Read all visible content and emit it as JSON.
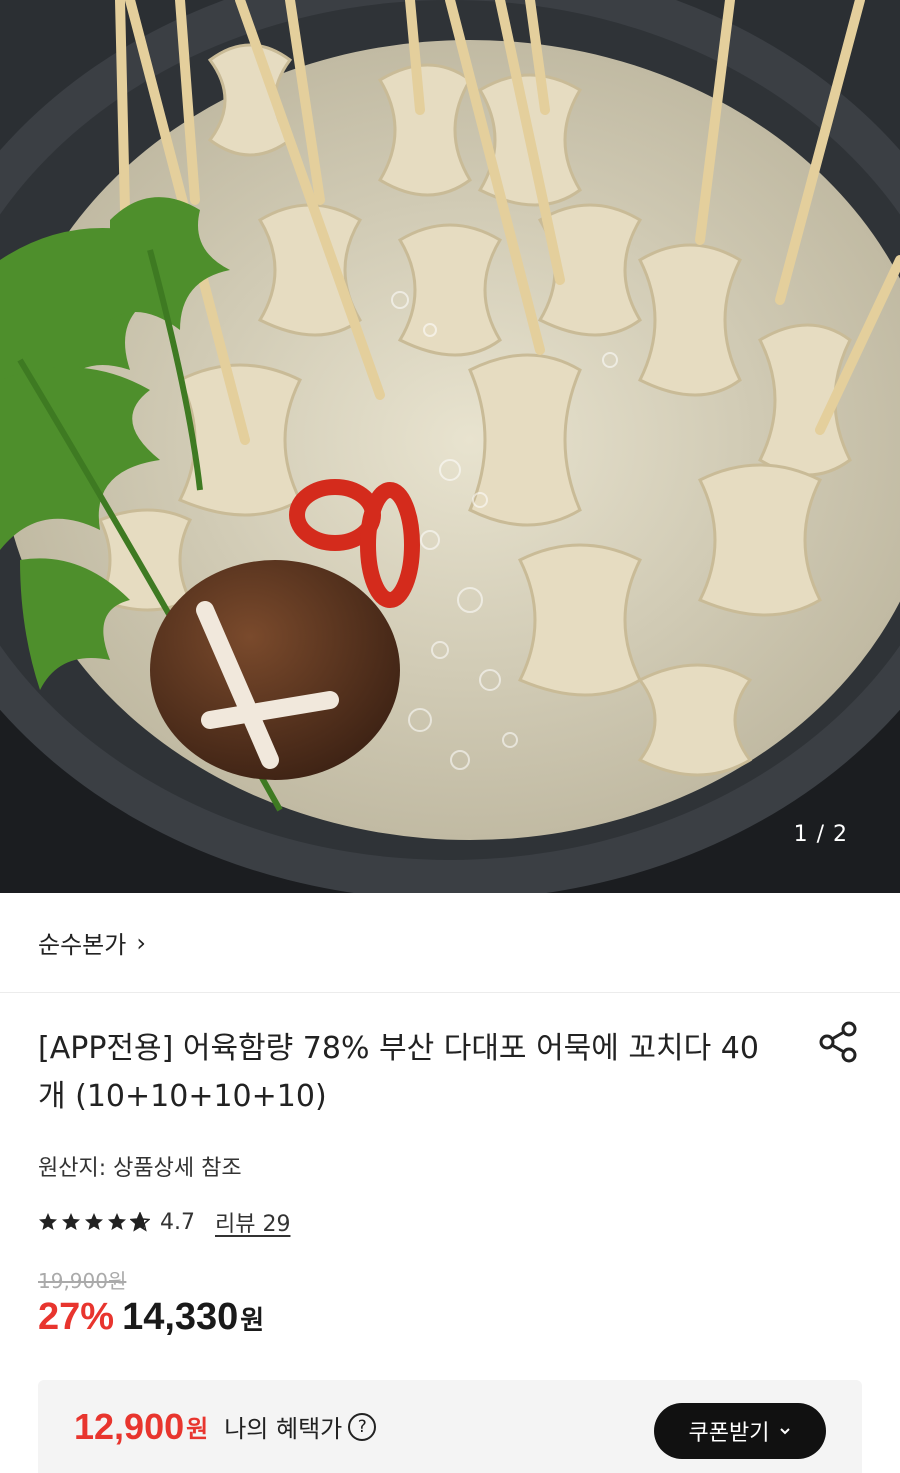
{
  "gallery": {
    "page_indicator": "1 / 2"
  },
  "brand": {
    "name": "순수본가",
    "chevron": "›"
  },
  "product": {
    "title": "[APP전용] 어육함량 78% 부산 다대포 어묵에 꼬치다 40개 (10+10+10+10)",
    "origin": "원산지: 상품상세 참조",
    "rating": "4.7",
    "rating_stars": 4.7,
    "review_link": "리뷰 29",
    "original_price": "19,900원",
    "discount": "27%",
    "price": "14,330",
    "price_unit": "원"
  },
  "benefit": {
    "price": "12,900",
    "price_unit": "원",
    "label": "나의 혜택가",
    "help_glyph": "?",
    "coupon_button": "쿠폰받기"
  },
  "icons": {
    "share": "share-icon",
    "star": "star-icon",
    "help": "question-circle-icon",
    "chevron_down": "chevron-down-icon"
  },
  "colors": {
    "accent_red": "#e8352e",
    "button_black": "#111111"
  }
}
